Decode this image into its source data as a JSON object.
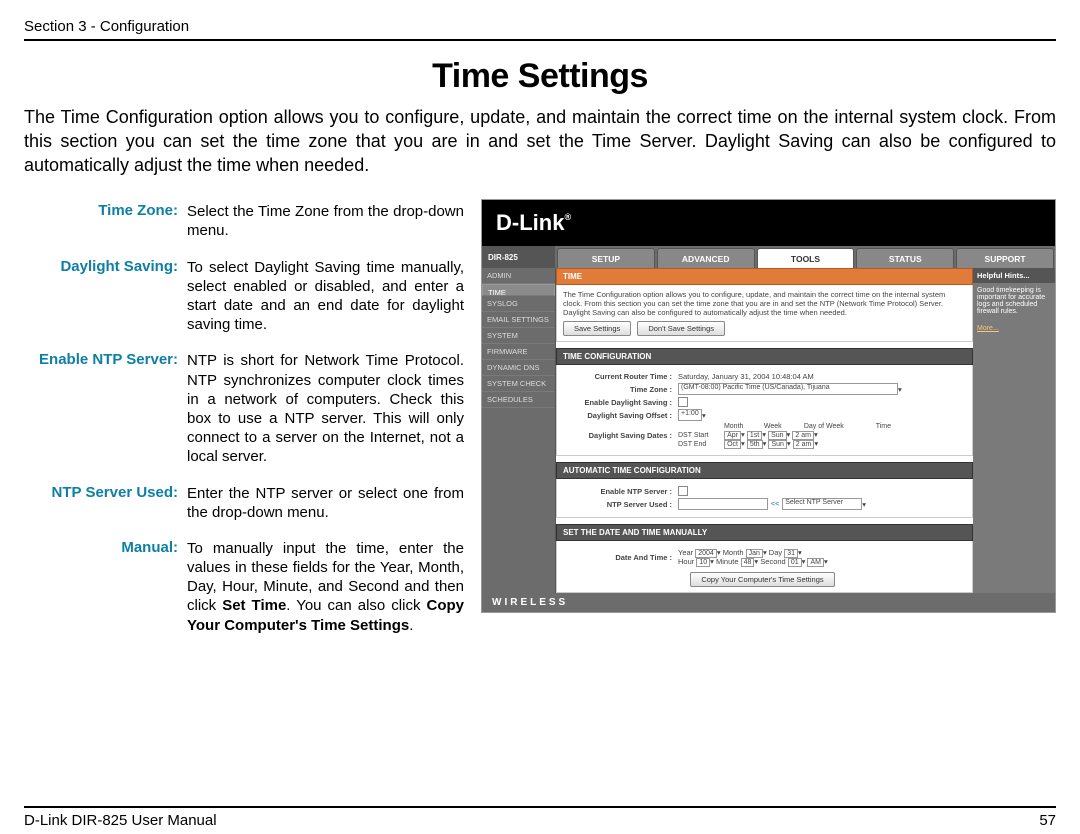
{
  "header": {
    "section": "Section 3 - Configuration"
  },
  "title": "Time Settings",
  "intro": "The Time Configuration option allows you to configure, update, and maintain the correct time on the internal system clock. From this section you can set the time zone that you are in and set the Time Server. Daylight Saving can also be configured to automatically adjust the time when needed.",
  "defs": {
    "tz_label": "Time Zone:",
    "tz_text": "Select the Time Zone from the drop-down menu.",
    "ds_label": "Daylight Saving:",
    "ds_text": "To select Daylight Saving time manually, select enabled or disabled, and enter a start date and an end date for daylight saving time.",
    "ntp_label": "Enable NTP Server:",
    "ntp_text": "NTP is short for Network Time Protocol. NTP synchronizes computer clock times in a network of computers. Check this box to use a NTP server. This will only connect to a server on the Internet, not a local server.",
    "ntpu_label": "NTP Server Used:",
    "ntpu_text": "Enter the NTP server or select one from the drop-down menu.",
    "man_label": "Manual:",
    "man_text_a": "To manually input the time, enter the values in these fields for the Year, Month, Day, Hour, Minute, and Second and then click ",
    "man_bold_a": "Set Time",
    "man_text_b": ". You can also click ",
    "man_bold_b": "Copy Your Computer's Time Settings",
    "man_text_c": "."
  },
  "shot": {
    "brand": "D-Link",
    "model": "DIR-825",
    "tabs": [
      "SETUP",
      "ADVANCED",
      "TOOLS",
      "STATUS",
      "SUPPORT"
    ],
    "active_tab": "TOOLS",
    "sidebar": [
      "ADMIN",
      "TIME",
      "SYSLOG",
      "EMAIL SETTINGS",
      "SYSTEM",
      "FIRMWARE",
      "DYNAMIC DNS",
      "SYSTEM CHECK",
      "SCHEDULES"
    ],
    "sidebar_sel": "TIME",
    "hints_head": "Helpful Hints...",
    "hints_body": "Good timekeeping is important for accurate logs and scheduled firewall rules.",
    "hints_more": "More...",
    "panel_time_head": "TIME",
    "panel_time_body": "The Time Configuration option allows you to configure, update, and maintain the correct time on the internal system clock. From this section you can set the time zone that you are in and set the NTP (Network Time Protocol) Server. Daylight Saving can also be configured to automatically adjust the time when needed.",
    "btn_save": "Save Settings",
    "btn_dont": "Don't Save Settings",
    "panel_cfg_head": "TIME CONFIGURATION",
    "crt_lbl": "Current Router Time :",
    "crt_val": "Saturday, January 31, 2004 10:48:04 AM",
    "tz_lbl": "Time Zone :",
    "tz_val": "(GMT-08:00) Pacific Time (US/Canada), Tijuana",
    "eds_lbl": "Enable Daylight Saving :",
    "dso_lbl": "Daylight Saving Offset :",
    "dso_val": "+1:00",
    "dsd_lbl": "Daylight Saving Dates :",
    "dsd_cols": {
      "m": "Month",
      "w": "Week",
      "d": "Day of Week",
      "t": "Time"
    },
    "dst_start": {
      "l": "DST Start",
      "m": "Apr",
      "w": "1st",
      "d": "Sun",
      "t": "2 am"
    },
    "dst_end": {
      "l": "DST End",
      "m": "Oct",
      "w": "5th",
      "d": "Sun",
      "t": "2 am"
    },
    "panel_auto_head": "AUTOMATIC TIME CONFIGURATION",
    "entp_lbl": "Enable NTP Server :",
    "ntpu_lbl": "NTP Server Used :",
    "ntpu_sel": "Select NTP Server",
    "ntpu_link": "<<",
    "panel_set_head": "SET THE DATE AND TIME MANUALLY",
    "dat_lbl": "Date And Time :",
    "dat": {
      "yl": "Year",
      "yv": "2004",
      "ml": "Month",
      "mv": "Jan",
      "dl": "Day",
      "dv": "31",
      "hl": "Hour",
      "hv": "10",
      "minl": "Minute",
      "minv": "48",
      "sl": "Second",
      "sv": "01",
      "ampm": "AM"
    },
    "btn_copy": "Copy Your Computer's Time Settings",
    "footer": "WIRELESS"
  },
  "footer": {
    "left": "D-Link DIR-825 User Manual",
    "page": "57"
  }
}
